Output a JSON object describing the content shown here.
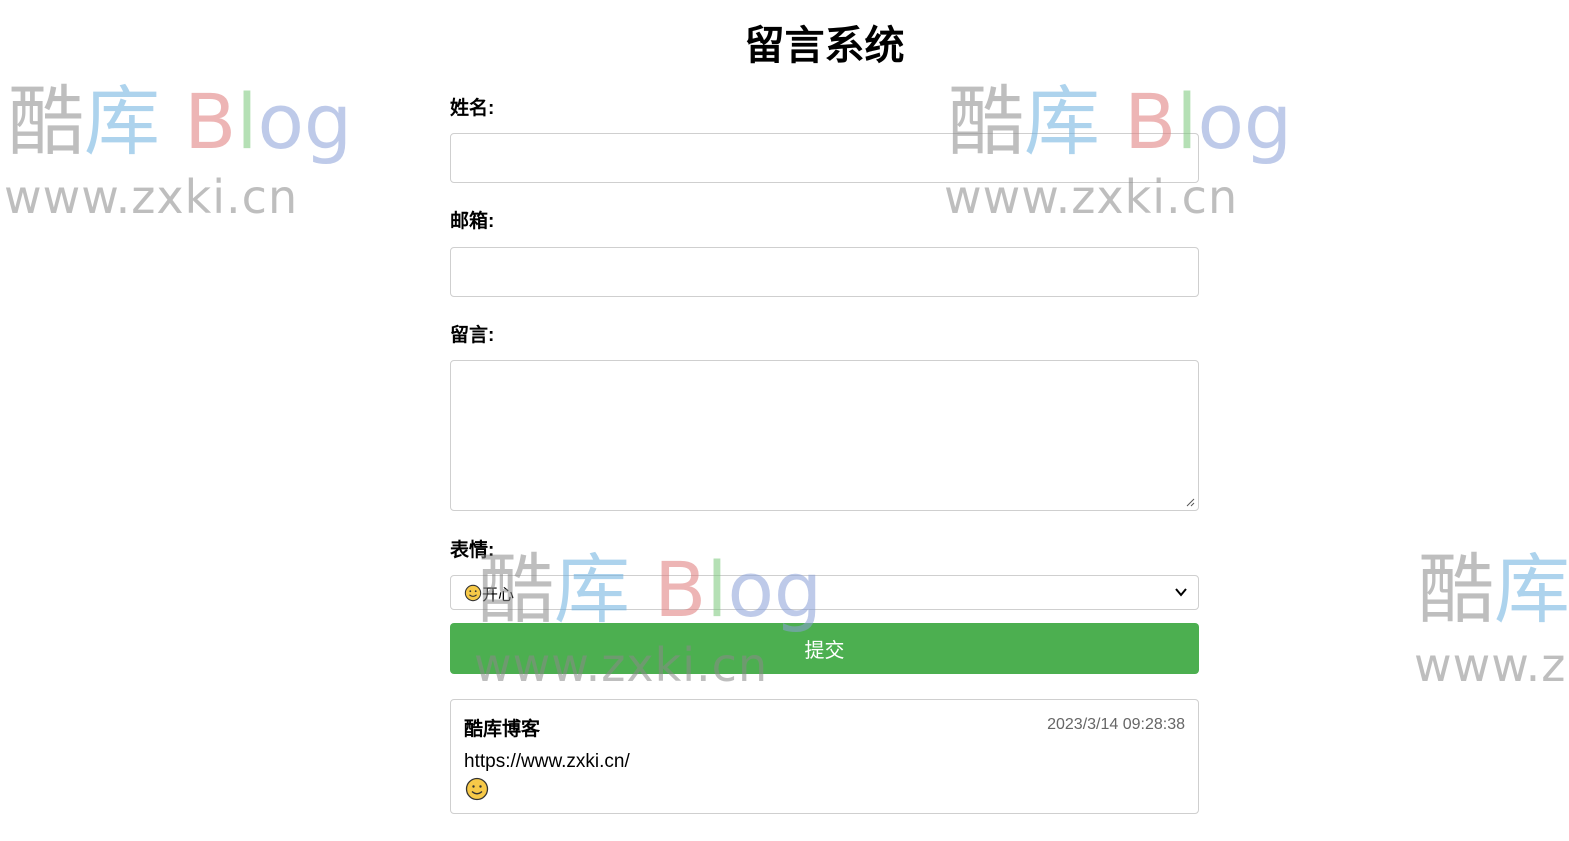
{
  "page": {
    "title": "留言系统"
  },
  "form": {
    "name_label": "姓名:",
    "name_value": "",
    "email_label": "邮箱:",
    "email_value": "",
    "message_label": "留言:",
    "message_value": "",
    "emoji_label": "表情:",
    "emoji_selected": "开心",
    "emoji_selected_icon": "smile-icon",
    "submit_label": "提交"
  },
  "messages": [
    {
      "author": "酷库博客",
      "time": "2023/3/14 09:28:38",
      "text": "https://www.zxki.cn/",
      "emoji_icon": "smile-icon"
    }
  ],
  "watermark": {
    "brand_cn_1": "酷",
    "brand_cn_2": "库",
    "brand_b": "B",
    "brand_l": "l",
    "brand_og": "og",
    "url": "www.zxki.cn",
    "url_cut": "www.z"
  },
  "colors": {
    "submit_bg": "#4caf50",
    "border": "#cfcfcf"
  }
}
